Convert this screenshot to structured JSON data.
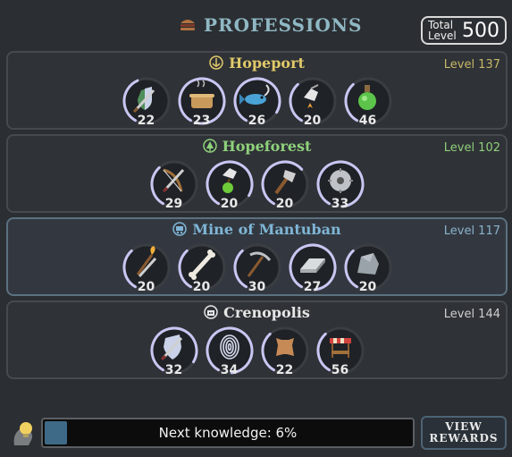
{
  "header": {
    "title": "PROFESSIONS",
    "title_icon": "hamburger-icon",
    "total_label_1": "Total",
    "total_label_2": "Level",
    "total_value": "500"
  },
  "regions": [
    {
      "name": "Hopeport",
      "icon": "anchor-icon",
      "level": "Level 137",
      "name_color": "#e0c96a",
      "level_color": "#c7b86a",
      "skills": [
        {
          "icon": "shield-sword-icon",
          "value": "22",
          "progress": 0.35
        },
        {
          "icon": "cooking-pot-icon",
          "value": "23",
          "progress": 0.95
        },
        {
          "icon": "fish-icon",
          "value": "26",
          "progress": 0.75
        },
        {
          "icon": "gathering-hand-icon",
          "value": "20",
          "progress": 0.3
        },
        {
          "icon": "potion-icon",
          "value": "46",
          "progress": 0.3
        }
      ]
    },
    {
      "name": "Hopeforest",
      "icon": "tree-icon",
      "level": "Level 102",
      "name_color": "#8fd17c",
      "level_color": "#8fcf7a",
      "skills": [
        {
          "icon": "sword-bow-icon",
          "value": "29",
          "progress": 0.3
        },
        {
          "icon": "apple-hand-icon",
          "value": "20",
          "progress": 0.75
        },
        {
          "icon": "axe-icon",
          "value": "20",
          "progress": 0.55
        },
        {
          "icon": "saw-blade-icon",
          "value": "33",
          "progress": 0.9
        }
      ]
    },
    {
      "name": "Mine of Mantuban",
      "icon": "minecart-icon",
      "level": "Level 117",
      "name_color": "#7fb6d6",
      "level_color": "#8ab3cc",
      "skills": [
        {
          "icon": "torch-sword-icon",
          "value": "20",
          "progress": 0.3
        },
        {
          "icon": "bone-icon",
          "value": "20",
          "progress": 0.3
        },
        {
          "icon": "pickaxe-icon",
          "value": "30",
          "progress": 0.3
        },
        {
          "icon": "metal-bar-icon",
          "value": "27",
          "progress": 0.9
        },
        {
          "icon": "stone-icon",
          "value": "20",
          "progress": 0.3
        }
      ]
    },
    {
      "name": "Crenopolis",
      "icon": "city-icon",
      "level": "Level 144",
      "name_color": "#e6e6e6",
      "level_color": "#cfcfcf",
      "skills": [
        {
          "icon": "armor-shield-icon",
          "value": "32",
          "progress": 0.75
        },
        {
          "icon": "fingerprint-icon",
          "value": "34",
          "progress": 0.9
        },
        {
          "icon": "leather-hide-icon",
          "value": "22",
          "progress": 0.3
        },
        {
          "icon": "market-stall-icon",
          "value": "56",
          "progress": 0.3
        }
      ]
    }
  ],
  "footer": {
    "bulb_icon": "lightbulb-head-icon",
    "progress_text": "Next knowledge:  6%",
    "progress_fraction": 0.06,
    "view_line1": "VIEW",
    "view_line2": "REWARDS"
  },
  "colors": {
    "arc": "#c9c6f2",
    "panel_bg": "#2f3236"
  }
}
